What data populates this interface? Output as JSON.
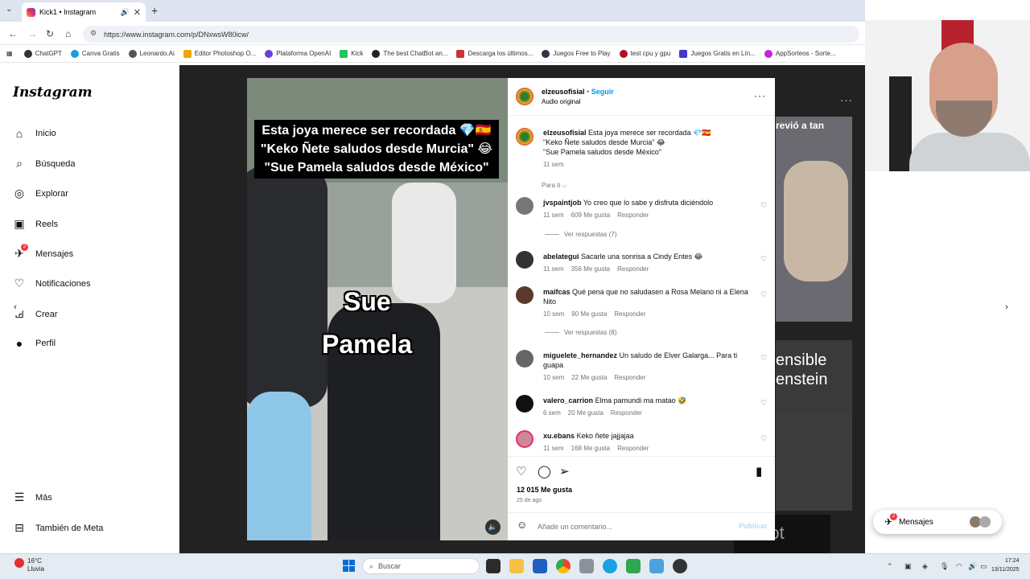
{
  "browser": {
    "tab_title": "Kick1 • Instagram",
    "url": "https://www.instagram.com/p/DNxwsW80icw/",
    "bookmarks": [
      "ChatGPT",
      "Canva Gratis",
      "Leonardo.Ai",
      "Editor Photoshop O...",
      "Plataforma OpenAI",
      "Kick",
      "The best ChatBot an...",
      "Descarga los últimos...",
      "Juegos Free to Play",
      "test cpu y gpu",
      "Juegos Gratis en Lín...",
      "AppSorteos - Sorte..."
    ]
  },
  "sidebar": {
    "logo": "Instagram",
    "items": [
      {
        "label": "Inicio"
      },
      {
        "label": "Búsqueda"
      },
      {
        "label": "Explorar"
      },
      {
        "label": "Reels"
      },
      {
        "label": "Mensajes",
        "badge": "2"
      },
      {
        "label": "Notificaciones"
      },
      {
        "label": "Crear"
      },
      {
        "label": "Perfil"
      }
    ],
    "more": "Más",
    "meta": "También de Meta"
  },
  "media": {
    "caption_lines": [
      "Esta joya merece ser recordada 💎🇪🇸",
      "\"Keko Ñete saludos desde Murcia\" 😂",
      "\"Sue Pamela saludos desde México\""
    ],
    "overlay_word_1": "Sue",
    "overlay_word_2": "Pamela"
  },
  "post": {
    "author": "elzeusofisial",
    "follow": "Seguir",
    "audio": "Audio original",
    "caption_line1": "Esta joya merece ser recordada 💎🇪🇸",
    "caption_line2": "\"Keko Ñete saludos desde Murcia\" 😂",
    "caption_line3": "\"Sue Pamela saludos desde México\"",
    "caption_time": "11 sem",
    "filter": "Para ti ⌵",
    "comments": [
      {
        "user": "jvspaintjob",
        "text": "Yo creo que lo sabe y disfruta diciéndolo",
        "time": "11 sem",
        "likes": "609 Me gusta",
        "reply": "Responder",
        "replies": "Ver respuestas (7)"
      },
      {
        "user": "abelategui",
        "text": "Sacarle una sonrisa a Cindy Entes 😂",
        "time": "11 sem",
        "likes": "356 Me gusta",
        "reply": "Responder"
      },
      {
        "user": "maifcas",
        "text": "Qué pena que no saludasen a Rosa Melano ni a Elena Nito",
        "time": "10 sem",
        "likes": "90 Me gusta",
        "reply": "Responder",
        "replies": "Ver respuestas (8)"
      },
      {
        "user": "miguelete_hernandez",
        "text": "Un saludo de Elver Galarga... Para ti guapa",
        "time": "10 sem",
        "likes": "22 Me gusta",
        "reply": "Responder"
      },
      {
        "user": "valero_carrion",
        "text": "Elma pamundi ma matao 🤣",
        "time": "6 sem",
        "likes": "20 Me gusta",
        "reply": "Responder"
      },
      {
        "user": "xu.ebans",
        "text": "Keko ñete jajjajaa",
        "time": "11 sem",
        "likes": "168 Me gusta",
        "reply": "Responder"
      }
    ],
    "likes_total": "12 015 Me gusta",
    "date": "25 de ago",
    "comment_placeholder": "Añade un comentario...",
    "publish": "Publicar"
  },
  "thumbs": {
    "t1": "revió a tan",
    "t2a": "ensible",
    "t2b": "enstein",
    "t4": "Robot"
  },
  "messages_pill": {
    "label": "Mensajes",
    "badge": "2"
  },
  "taskbar": {
    "temp": "16°C",
    "weather": "Lluvia",
    "search": "Buscar",
    "time": "17:24",
    "date": "13/11/2025"
  }
}
